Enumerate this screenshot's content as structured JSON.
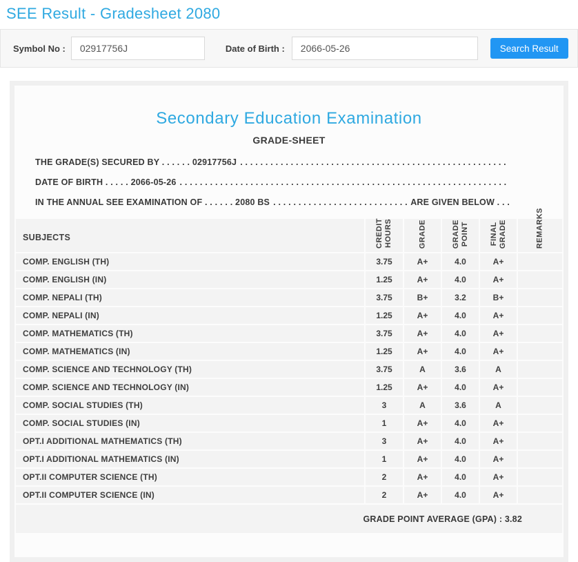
{
  "page": {
    "title": "SEE Result - Gradesheet 2080"
  },
  "search": {
    "symbol_label": "Symbol No :",
    "symbol_value": "02917756J",
    "dob_label": "Date of Birth :",
    "dob_value": "2066-05-26",
    "button_label": "Search Result"
  },
  "gradesheet": {
    "heading": "Secondary Education Examination",
    "subheading": "GRADE-SHEET",
    "dot_fill": ". . . . . . . . . . . . . . . . . . . . . . . . . . . . . . . . . . . . . . . . . . . . . . . . . . . . . . . . . . . . . . . . . . . . . . . . . . . . . . . .",
    "info_lines": [
      {
        "left": "THE GRADE(S) SECURED BY . . . . . . 02917756J",
        "right": ""
      },
      {
        "left": "DATE OF BIRTH . . . . . 2066-05-26",
        "right": ""
      },
      {
        "left": "IN THE ANNUAL SEE EXAMINATION OF . . . . . . 2080 BS",
        "right": "ARE GIVEN BELOW . . ."
      }
    ],
    "table": {
      "headers": [
        "SUBJECTS",
        "CREDIT\nHOURS",
        "GRADE",
        "GRADE\nPOINT",
        "FINAL\nGRADE",
        "REMARKS"
      ],
      "rows": [
        {
          "subject": "COMP. ENGLISH (TH)",
          "credit": "3.75",
          "grade": "A+",
          "point": "4.0",
          "final": "A+",
          "remarks": ""
        },
        {
          "subject": "COMP. ENGLISH (IN)",
          "credit": "1.25",
          "grade": "A+",
          "point": "4.0",
          "final": "A+",
          "remarks": ""
        },
        {
          "subject": "COMP. NEPALI (TH)",
          "credit": "3.75",
          "grade": "B+",
          "point": "3.2",
          "final": "B+",
          "remarks": ""
        },
        {
          "subject": "COMP. NEPALI (IN)",
          "credit": "1.25",
          "grade": "A+",
          "point": "4.0",
          "final": "A+",
          "remarks": ""
        },
        {
          "subject": "COMP. MATHEMATICS (TH)",
          "credit": "3.75",
          "grade": "A+",
          "point": "4.0",
          "final": "A+",
          "remarks": ""
        },
        {
          "subject": "COMP. MATHEMATICS (IN)",
          "credit": "1.25",
          "grade": "A+",
          "point": "4.0",
          "final": "A+",
          "remarks": ""
        },
        {
          "subject": "COMP. SCIENCE AND TECHNOLOGY (TH)",
          "credit": "3.75",
          "grade": "A",
          "point": "3.6",
          "final": "A",
          "remarks": ""
        },
        {
          "subject": "COMP. SCIENCE AND TECHNOLOGY (IN)",
          "credit": "1.25",
          "grade": "A+",
          "point": "4.0",
          "final": "A+",
          "remarks": ""
        },
        {
          "subject": "COMP. SOCIAL STUDIES (TH)",
          "credit": "3",
          "grade": "A",
          "point": "3.6",
          "final": "A",
          "remarks": ""
        },
        {
          "subject": "COMP. SOCIAL STUDIES (IN)",
          "credit": "1",
          "grade": "A+",
          "point": "4.0",
          "final": "A+",
          "remarks": ""
        },
        {
          "subject": "OPT.I ADDITIONAL MATHEMATICS (TH)",
          "credit": "3",
          "grade": "A+",
          "point": "4.0",
          "final": "A+",
          "remarks": ""
        },
        {
          "subject": "OPT.I ADDITIONAL MATHEMATICS (IN)",
          "credit": "1",
          "grade": "A+",
          "point": "4.0",
          "final": "A+",
          "remarks": ""
        },
        {
          "subject": "OPT.II COMPUTER SCIENCE (TH)",
          "credit": "2",
          "grade": "A+",
          "point": "4.0",
          "final": "A+",
          "remarks": ""
        },
        {
          "subject": "OPT.II COMPUTER SCIENCE (IN)",
          "credit": "2",
          "grade": "A+",
          "point": "4.0",
          "final": "A+",
          "remarks": ""
        }
      ],
      "footer": "GRADE POINT AVERAGE (GPA) : 3.82"
    }
  },
  "colors": {
    "accent_cyan": "#2fa9e1",
    "button_blue": "#2196f3",
    "panel_gray": "#f7f7f7",
    "row_gray": "#f3f3f3"
  }
}
